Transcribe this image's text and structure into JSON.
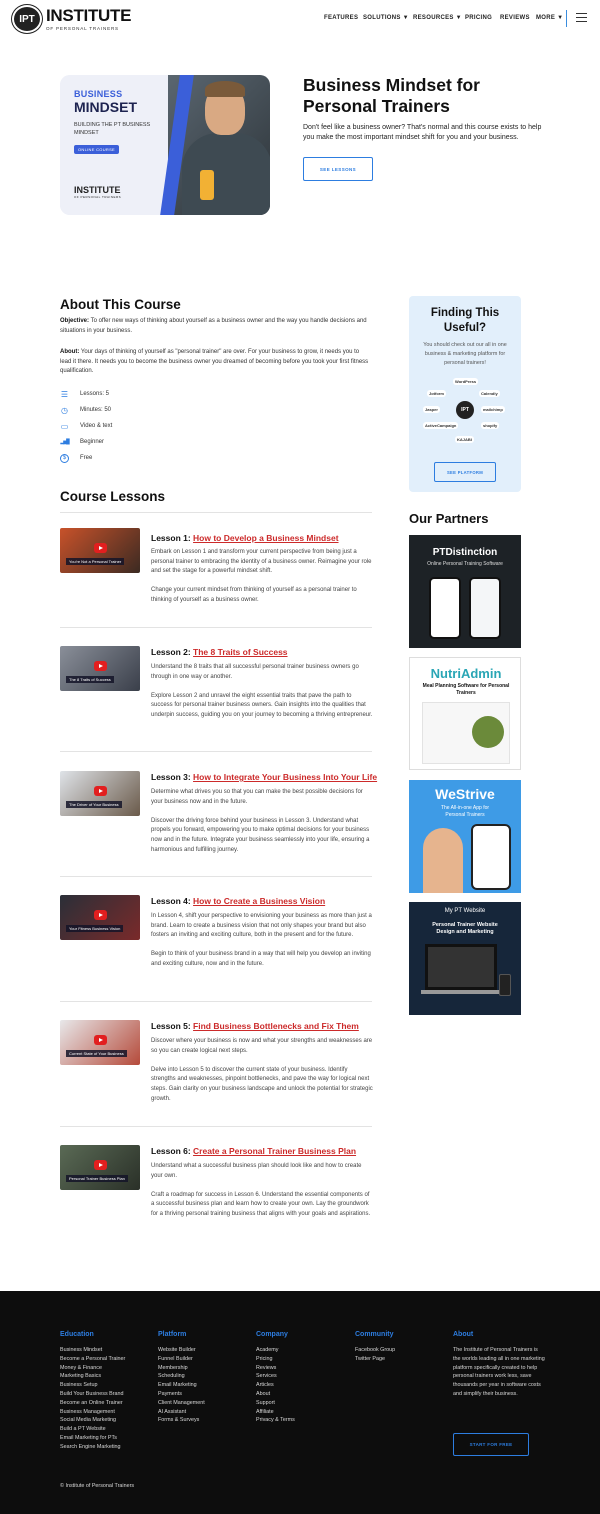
{
  "header": {
    "logo_emblem": "IPT",
    "logo_title": "INSTITUTE",
    "logo_subtitle": "OF PERSONAL TRAINERS",
    "nav": [
      "FEATURES",
      "SOLUTIONS ▼",
      "RESOURCES ▼",
      "PRICING",
      "REVIEWS",
      "MORE ▼"
    ]
  },
  "hero": {
    "image": {
      "line1": "BUSINESS",
      "line2": "MINDSET",
      "line3": "BUILDING THE PT BUSINESS MINDSET",
      "badge": "ONLINE COURSE",
      "logo": "INSTITUTE",
      "logo_sub": "OF PERSONAL TRAINERS"
    },
    "title": "Business Mindset for Personal Trainers",
    "description": "Don't feel like a business owner? That's normal and this course exists to help you make the most important mindset shift for you and your business.",
    "button": "SEE LESSONS"
  },
  "about": {
    "heading": "About This Course",
    "objective_label": "Objective:",
    "objective_text": " To offer new ways of thinking about yourself as a business owner and the way you handle decisions and situations in your business.",
    "about_label": "About:",
    "about_text": " Your days of thinking of yourself as \"personal trainer\" are over. For your business to grow, it needs you to lead it there. It needs you to become the business owner you dreamed of becoming before you took your first fitness qualification.",
    "facts": [
      {
        "icon": "list-icon",
        "glyph": "☰",
        "text": "Lessons: 5"
      },
      {
        "icon": "clock-icon",
        "glyph": "◷",
        "text": "Minutes: 50"
      },
      {
        "icon": "video-icon",
        "glyph": "▭",
        "text": "Video & text"
      },
      {
        "icon": "level-icon",
        "glyph": "▂▅█",
        "text": "Beginner"
      },
      {
        "icon": "dollar-icon",
        "glyph": "$",
        "text": "Free"
      }
    ]
  },
  "lessons_heading": "Course Lessons",
  "lessons": [
    {
      "prefix": "Lesson 1: ",
      "title": "How to Develop a Business Mindset",
      "thumb_caption": "You're Not a Personal Trainer",
      "p1": "Embark on Lesson 1 and transform your current perspective from being just a personal trainer to embracing the identity of a business owner. Reimagine your role and set the stage for a powerful mindset shift.",
      "p2": "Change your current mindset from thinking of yourself as a personal trainer to thinking of yourself as a business owner."
    },
    {
      "prefix": "Lesson 2: ",
      "title": "The 8 Traits of Success",
      "thumb_caption": "The 8 Traits of Success",
      "p1": "Understand the 8 traits that all successful personal trainer business owners go through in one way or another.",
      "p2": "Explore Lesson 2 and unravel the eight essential traits that pave the path to success for personal trainer business owners. Gain insights into the qualities that underpin success, guiding you on your journey to becoming a thriving entrepreneur."
    },
    {
      "prefix": "Lesson 3: ",
      "title": "How to Integrate Your Business Into Your Life",
      "thumb_caption": "The Driver of Your Business",
      "p1": "Determine what drives you so that you can make the best possible decisions for your business now and in the future.",
      "p2": "Discover the driving force behind your business in Lesson 3. Understand what propels you forward, empowering you to make optimal decisions for your business now and in the future. Integrate your business seamlessly into your life, ensuring a harmonious and fulfilling journey."
    },
    {
      "prefix": "Lesson 4: ",
      "title": "How to Create a Business Vision",
      "thumb_caption": "Your Fitness Business Vision",
      "p1": "In Lesson 4, shift your perspective to envisioning your business as more than just a brand. Learn to create a business vision that not only shapes your brand but also fosters an inviting and exciting culture, both in the present and for the future.",
      "p2": "Begin to think of your business brand in a way that will help you develop an inviting and exciting culture, now and in the future."
    },
    {
      "prefix": "Lesson 5: ",
      "title": "Find Business Bottlenecks and Fix Them",
      "thumb_caption": "Current State of Your Business",
      "p1": "Discover where your business is now and what your strengths and weaknesses are so you can create logical next steps.",
      "p2": "Delve into Lesson 5 to discover the current state of your business. Identify strengths and weaknesses, pinpoint bottlenecks, and pave the way for logical next steps. Gain clarity on your business landscape and unlock the potential for strategic growth."
    },
    {
      "prefix": "Lesson 6: ",
      "title": "Create a Personal Trainer Business Plan",
      "thumb_caption": "Personal Trainer Business Plan",
      "p1": "Understand what a successful business plan should look like and how to create your own.",
      "p2": "Craft a roadmap for success in Lesson 6. Understand the essential components of a successful business plan and learn how to create your own. Lay the groundwork for a thriving personal training business that aligns with your goals and aspirations."
    }
  ],
  "sidebar": {
    "useful_title": "Finding This Useful?",
    "useful_sub": "You should check out our all in one business & marketing platform for personal trainers!",
    "integrations": [
      "WordPress",
      "Calendly",
      "mailchimp",
      "shopify",
      "KAJABI",
      "Jasper",
      "Jotform",
      "ActiveCampaign",
      "Gmail Marketing"
    ],
    "hub": "IPT",
    "button": "SEE PLATFORM",
    "partners_heading": "Our Partners",
    "partners": [
      {
        "name": "PTDistinction",
        "tag": "Online Personal Training Software"
      },
      {
        "name": "NutriAdmin",
        "tag": "Meal Planning Software for Personal Trainers"
      },
      {
        "name": "WeStrive",
        "tag": "The All-in-one App for Personal Trainers"
      },
      {
        "name": "My PT Website",
        "tag": "Personal Trainer Website Design and Marketing"
      }
    ]
  },
  "footer": {
    "columns": [
      {
        "heading": "Education",
        "links": [
          "Business Mindset",
          "Become a Personal Trainer",
          "Money & Finance",
          "Marketing Basics",
          "Business Setup",
          "Build Your Business Brand",
          "Become an Online Trainer",
          "Business Management",
          "Social Media Marketing",
          "Build a PT Website",
          "Email Marketing for PTs",
          "Search Engine Marketing"
        ]
      },
      {
        "heading": "Platform",
        "links": [
          "Website Builder",
          "Funnel Builder",
          "Membership",
          "Scheduling",
          "Email Marketing",
          "Payments",
          "Client Management",
          "AI Assistant",
          "Forms & Surveys"
        ]
      },
      {
        "heading": "Company",
        "links": [
          "Academy",
          "Pricing",
          "Reviews",
          "Services",
          "Articles",
          "About",
          "Support",
          "Affiliate",
          "Privacy & Terms"
        ]
      },
      {
        "heading": "Community",
        "links": [
          "Facebook Group",
          "Twitter Page"
        ]
      }
    ],
    "about_heading": "About",
    "about_text": "The Institute of Personal Trainers is the worlds leading all in one marketing platform specifically created to help personal trainers work less, save thousands per year in software costs and simplify their business.",
    "button": "START FOR FREE",
    "copyright": "© Institute of Personal Trainers"
  }
}
